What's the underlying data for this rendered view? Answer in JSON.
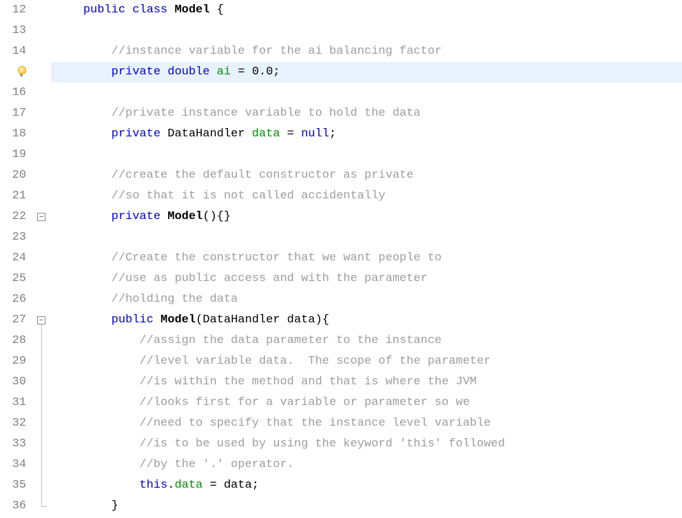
{
  "editor": {
    "highlighted_line": 15,
    "fold_markers": {
      "22": "box",
      "27": "box"
    },
    "fold_ruler_start": 27,
    "fold_ruler_end": 36,
    "lines": [
      {
        "num": "12",
        "marker": "none",
        "tokens": [
          {
            "cls": "indent",
            "t": "    "
          },
          {
            "cls": "tok-kw",
            "t": "public"
          },
          {
            "cls": "tok-plain",
            "t": " "
          },
          {
            "cls": "tok-kw",
            "t": "class"
          },
          {
            "cls": "tok-plain",
            "t": " "
          },
          {
            "cls": "tok-cls",
            "t": "Model"
          },
          {
            "cls": "tok-plain",
            "t": " {"
          }
        ]
      },
      {
        "num": "13",
        "marker": "none",
        "tokens": []
      },
      {
        "num": "14",
        "marker": "none",
        "tokens": [
          {
            "cls": "indent",
            "t": "        "
          },
          {
            "cls": "tok-comment",
            "t": "//instance variable for the ai balancing factor"
          }
        ]
      },
      {
        "num": "",
        "marker": "bulb",
        "highlight": true,
        "tokens": [
          {
            "cls": "indent",
            "t": "        "
          },
          {
            "cls": "tok-kw",
            "t": "private"
          },
          {
            "cls": "tok-plain",
            "t": " "
          },
          {
            "cls": "tok-kw",
            "t": "double"
          },
          {
            "cls": "tok-plain",
            "t": " "
          },
          {
            "cls": "tok-var",
            "t": "ai"
          },
          {
            "cls": "tok-plain",
            "t": " = "
          },
          {
            "cls": "tok-num",
            "t": "0.0"
          },
          {
            "cls": "tok-plain",
            "t": ";"
          }
        ]
      },
      {
        "num": "16",
        "marker": "none",
        "tokens": []
      },
      {
        "num": "17",
        "marker": "none",
        "tokens": [
          {
            "cls": "indent",
            "t": "        "
          },
          {
            "cls": "tok-comment",
            "t": "//private instance variable to hold the data"
          }
        ]
      },
      {
        "num": "18",
        "marker": "none",
        "tokens": [
          {
            "cls": "indent",
            "t": "        "
          },
          {
            "cls": "tok-kw",
            "t": "private"
          },
          {
            "cls": "tok-plain",
            "t": " DataHandler "
          },
          {
            "cls": "tok-var",
            "t": "data"
          },
          {
            "cls": "tok-plain",
            "t": " = "
          },
          {
            "cls": "tok-kw",
            "t": "null"
          },
          {
            "cls": "tok-plain",
            "t": ";"
          }
        ]
      },
      {
        "num": "19",
        "marker": "none",
        "tokens": []
      },
      {
        "num": "20",
        "marker": "none",
        "tokens": [
          {
            "cls": "indent",
            "t": "        "
          },
          {
            "cls": "tok-comment",
            "t": "//create the default constructor as private"
          }
        ]
      },
      {
        "num": "21",
        "marker": "none",
        "tokens": [
          {
            "cls": "indent",
            "t": "        "
          },
          {
            "cls": "tok-comment",
            "t": "//so that it is not called accidentally"
          }
        ]
      },
      {
        "num": "22",
        "marker": "fold-box",
        "tokens": [
          {
            "cls": "indent",
            "t": "        "
          },
          {
            "cls": "tok-kw",
            "t": "private"
          },
          {
            "cls": "tok-plain",
            "t": " "
          },
          {
            "cls": "tok-cls",
            "t": "Model"
          },
          {
            "cls": "tok-plain",
            "t": "(){}"
          }
        ]
      },
      {
        "num": "23",
        "marker": "none",
        "tokens": []
      },
      {
        "num": "24",
        "marker": "none",
        "tokens": [
          {
            "cls": "indent",
            "t": "        "
          },
          {
            "cls": "tok-comment",
            "t": "//Create the constructor that we want people to"
          }
        ]
      },
      {
        "num": "25",
        "marker": "none",
        "tokens": [
          {
            "cls": "indent",
            "t": "        "
          },
          {
            "cls": "tok-comment",
            "t": "//use as public access and with the parameter"
          }
        ]
      },
      {
        "num": "26",
        "marker": "none",
        "tokens": [
          {
            "cls": "indent",
            "t": "        "
          },
          {
            "cls": "tok-comment",
            "t": "//holding the data"
          }
        ]
      },
      {
        "num": "27",
        "marker": "fold-box-ruler-start",
        "tokens": [
          {
            "cls": "indent",
            "t": "        "
          },
          {
            "cls": "tok-kw",
            "t": "public"
          },
          {
            "cls": "tok-plain",
            "t": " "
          },
          {
            "cls": "tok-cls",
            "t": "Model"
          },
          {
            "cls": "tok-plain",
            "t": "(DataHandler data){"
          }
        ]
      },
      {
        "num": "28",
        "marker": "ruler",
        "tokens": [
          {
            "cls": "indent",
            "t": "            "
          },
          {
            "cls": "tok-comment",
            "t": "//assign the data parameter to the instance"
          }
        ]
      },
      {
        "num": "29",
        "marker": "ruler",
        "tokens": [
          {
            "cls": "indent",
            "t": "            "
          },
          {
            "cls": "tok-comment",
            "t": "//level variable data.  The scope of the parameter"
          }
        ]
      },
      {
        "num": "30",
        "marker": "ruler",
        "tokens": [
          {
            "cls": "indent",
            "t": "            "
          },
          {
            "cls": "tok-comment",
            "t": "//is within the method and that is where the JVM"
          }
        ]
      },
      {
        "num": "31",
        "marker": "ruler",
        "tokens": [
          {
            "cls": "indent",
            "t": "            "
          },
          {
            "cls": "tok-comment",
            "t": "//looks first for a variable or parameter so we"
          }
        ]
      },
      {
        "num": "32",
        "marker": "ruler",
        "tokens": [
          {
            "cls": "indent",
            "t": "            "
          },
          {
            "cls": "tok-comment",
            "t": "//need to specify that the instance level variable"
          }
        ]
      },
      {
        "num": "33",
        "marker": "ruler",
        "tokens": [
          {
            "cls": "indent",
            "t": "            "
          },
          {
            "cls": "tok-comment",
            "t": "//is to be used by using the keyword 'this' followed"
          }
        ]
      },
      {
        "num": "34",
        "marker": "ruler",
        "tokens": [
          {
            "cls": "indent",
            "t": "            "
          },
          {
            "cls": "tok-comment",
            "t": "//by the '.' operator."
          }
        ]
      },
      {
        "num": "35",
        "marker": "ruler",
        "tokens": [
          {
            "cls": "indent",
            "t": "            "
          },
          {
            "cls": "tok-kw",
            "t": "this"
          },
          {
            "cls": "tok-plain",
            "t": "."
          },
          {
            "cls": "tok-var",
            "t": "data"
          },
          {
            "cls": "tok-plain",
            "t": " = data;"
          }
        ]
      },
      {
        "num": "36",
        "marker": "ruler-end",
        "tokens": [
          {
            "cls": "indent",
            "t": "        "
          },
          {
            "cls": "tok-plain",
            "t": "}"
          }
        ]
      }
    ]
  },
  "fold_glyph": "−"
}
